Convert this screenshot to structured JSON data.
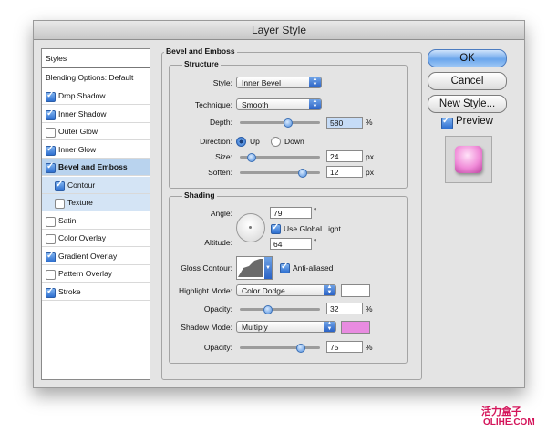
{
  "window": {
    "title": "Layer Style"
  },
  "styles_list": {
    "header": "Styles",
    "blending": "Blending Options: Default",
    "items": [
      {
        "label": "Drop Shadow",
        "checked": true
      },
      {
        "label": "Inner Shadow",
        "checked": true
      },
      {
        "label": "Outer Glow",
        "checked": false
      },
      {
        "label": "Inner Glow",
        "checked": true
      },
      {
        "label": "Bevel and Emboss",
        "checked": true
      },
      {
        "label": "Contour",
        "checked": true
      },
      {
        "label": "Texture",
        "checked": false
      },
      {
        "label": "Satin",
        "checked": false
      },
      {
        "label": "Color Overlay",
        "checked": false
      },
      {
        "label": "Gradient Overlay",
        "checked": true
      },
      {
        "label": "Pattern Overlay",
        "checked": false
      },
      {
        "label": "Stroke",
        "checked": true
      }
    ]
  },
  "bevel": {
    "title": "Bevel and Emboss",
    "structure": {
      "title": "Structure",
      "style_label": "Style:",
      "style_value": "Inner Bevel",
      "technique_label": "Technique:",
      "technique_value": "Smooth",
      "depth_label": "Depth:",
      "depth_value": "580",
      "depth_unit": "%",
      "direction_label": "Direction:",
      "dir_up": "Up",
      "dir_down": "Down",
      "size_label": "Size:",
      "size_value": "24",
      "size_unit": "px",
      "soften_label": "Soften:",
      "soften_value": "12",
      "soften_unit": "px"
    },
    "shading": {
      "title": "Shading",
      "angle_label": "Angle:",
      "angle_value": "79",
      "angle_unit": "°",
      "global_light": "Use Global Light",
      "altitude_label": "Altitude:",
      "altitude_value": "64",
      "altitude_unit": "°",
      "gloss_label": "Gloss Contour:",
      "anti_aliased": "Anti-aliased",
      "highlight_label": "Highlight Mode:",
      "highlight_value": "Color Dodge",
      "highlight_color": "#ffffff",
      "hl_opacity_label": "Opacity:",
      "hl_opacity_value": "32",
      "hl_opacity_unit": "%",
      "shadow_label": "Shadow Mode:",
      "shadow_value": "Multiply",
      "shadow_color": "#e88be0",
      "sh_opacity_label": "Opacity:",
      "sh_opacity_value": "75",
      "sh_opacity_unit": "%"
    }
  },
  "buttons": {
    "ok": "OK",
    "cancel": "Cancel",
    "new_style": "New Style...",
    "preview": "Preview"
  },
  "watermark": {
    "cn": "活力盒子",
    "site": "OLIHE.COM"
  }
}
